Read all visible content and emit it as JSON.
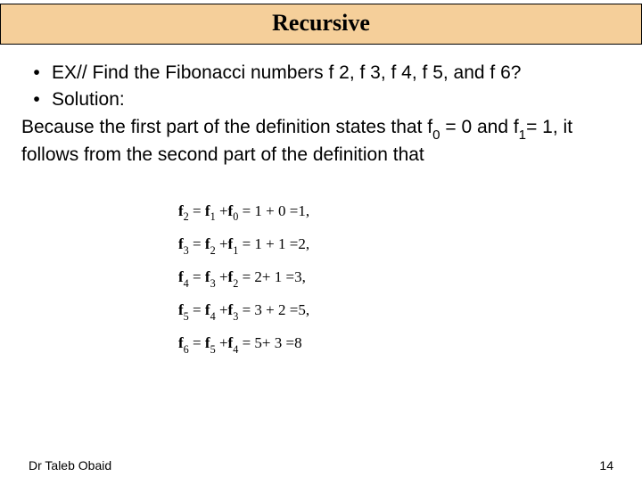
{
  "title": "Recursive",
  "bullets": [
    "EX// Find the Fibonacci numbers f 2, f 3, f 4, f 5, and f 6?",
    "Solution:"
  ],
  "paragraph_before_f0": "Because the first part of the definition states that f",
  "paragraph_mid": " = 0 and f",
  "paragraph_after": "= 1, it follows from the second part of the definition that",
  "sub0": "0",
  "sub1": "1",
  "equations": {
    "f2": {
      "lhs": "f",
      "lsub": "2",
      "a": "f",
      "asub": "1",
      "b": "f",
      "bsub": "0",
      "rhs": "= 1 + 0 =1,"
    },
    "f3": {
      "lhs": "f",
      "lsub": "3",
      "a": "f",
      "asub": "2",
      "b": "f",
      "bsub": "1",
      "rhs": "= 1 + 1 =2,"
    },
    "f4": {
      "lhs": "f",
      "lsub": "4",
      "a": "f",
      "asub": "3",
      "b": "f",
      "bsub": "2",
      "rhs": "= 2+ 1 =3,"
    },
    "f5": {
      "lhs": "f",
      "lsub": "5",
      "a": "f",
      "asub": "4",
      "b": "f",
      "bsub": "3",
      "rhs": "= 3 + 2 =5,"
    },
    "f6": {
      "lhs": "f",
      "lsub": "6",
      "a": "f",
      "asub": "5",
      "b": "f",
      "bsub": "4",
      "rhs": "= 5+ 3 =8"
    }
  },
  "footer": {
    "author": "Dr Taleb Obaid",
    "page": "14"
  }
}
